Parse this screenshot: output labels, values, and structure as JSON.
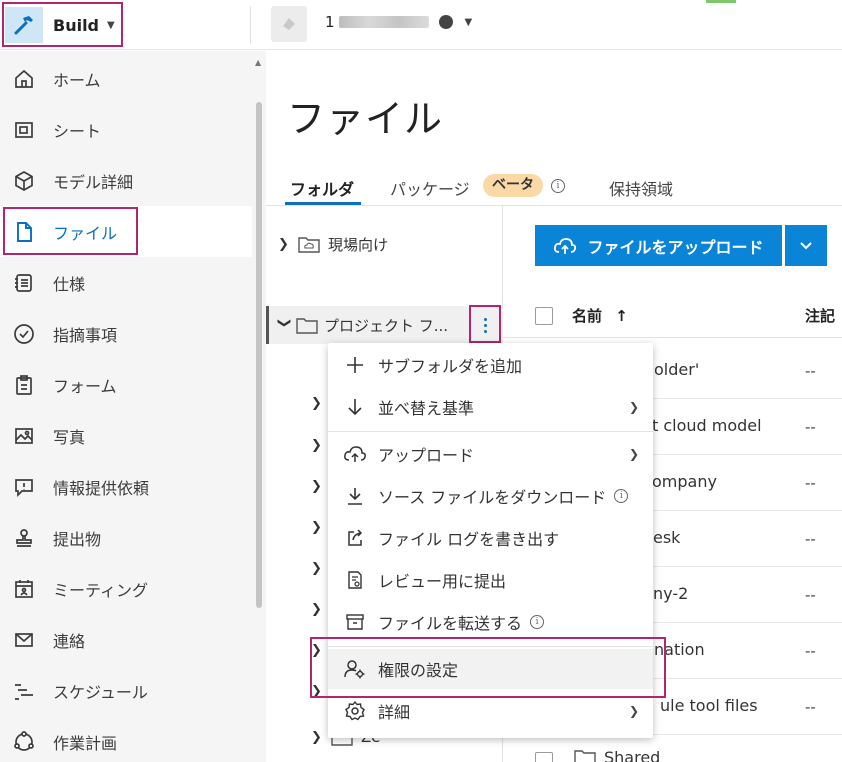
{
  "app": {
    "switcher_label": "Build",
    "project_prefix": "1"
  },
  "sidebar": {
    "items": [
      {
        "label": "ホーム",
        "icon": "home-icon"
      },
      {
        "label": "シート",
        "icon": "sheet-icon"
      },
      {
        "label": "モデル詳細",
        "icon": "cube-icon"
      },
      {
        "label": "ファイル",
        "icon": "file-icon",
        "active": true
      },
      {
        "label": "仕様",
        "icon": "spec-icon"
      },
      {
        "label": "指摘事項",
        "icon": "check-circle-icon"
      },
      {
        "label": "フォーム",
        "icon": "clipboard-icon"
      },
      {
        "label": "写真",
        "icon": "photo-icon"
      },
      {
        "label": "情報提供依頼",
        "icon": "rfi-icon"
      },
      {
        "label": "提出物",
        "icon": "stamp-icon"
      },
      {
        "label": "ミーティング",
        "icon": "calendar-people-icon"
      },
      {
        "label": "連絡",
        "icon": "mail-icon"
      },
      {
        "label": "スケジュール",
        "icon": "schedule-icon"
      },
      {
        "label": "作業計画",
        "icon": "work-plan-icon"
      }
    ]
  },
  "main": {
    "title": "ファイル",
    "tabs": [
      {
        "label": "フォルダ",
        "active": true
      },
      {
        "label": "パッケージ"
      },
      {
        "label": "保持領域"
      }
    ],
    "beta_badge": "ベータ",
    "info_glyph": "i",
    "tree": {
      "site_folder": "現場向け",
      "project_folder": "プロジェクト フ...",
      "partial_child": "Ze"
    },
    "upload_button": "ファイルをアップロード",
    "list": {
      "col_name": "名前",
      "sort_arrow": "↑",
      "col_note": "注記",
      "rows": [
        {
          "name": "older'",
          "note": "--"
        },
        {
          "name": "t cloud model",
          "note": "--"
        },
        {
          "name": "ompany",
          "note": "--"
        },
        {
          "name": "esk",
          "note": "--"
        },
        {
          "name": "ny-2",
          "note": "--"
        },
        {
          "name": "nation",
          "note": "--"
        },
        {
          "name": "ule tool files",
          "note": "--"
        },
        {
          "name": "Shared",
          "note": ""
        }
      ]
    }
  },
  "context_menu": {
    "items": [
      {
        "label": "サブフォルダを追加",
        "icon": "plus-icon"
      },
      {
        "label": "並べ替え基準",
        "icon": "arrow-down-icon",
        "submenu": true
      },
      {
        "label": "アップロード",
        "icon": "cloud-upload-icon",
        "submenu": true
      },
      {
        "label": "ソース ファイルをダウンロード",
        "icon": "download-icon",
        "info": true
      },
      {
        "label": "ファイル ログを書き出す",
        "icon": "export-icon"
      },
      {
        "label": "レビュー用に提出",
        "icon": "review-icon"
      },
      {
        "label": "ファイルを転送する",
        "icon": "archive-icon",
        "info": true
      },
      {
        "label": "権限の設定",
        "icon": "user-gear-icon"
      },
      {
        "label": "詳細",
        "icon": "gear-icon",
        "submenu": true
      }
    ]
  },
  "colors": {
    "accent": "#0a6fbd",
    "upload_button": "#0a84d6",
    "highlight_box": "#b0266f",
    "beta_badge": "#fbd9a6"
  }
}
